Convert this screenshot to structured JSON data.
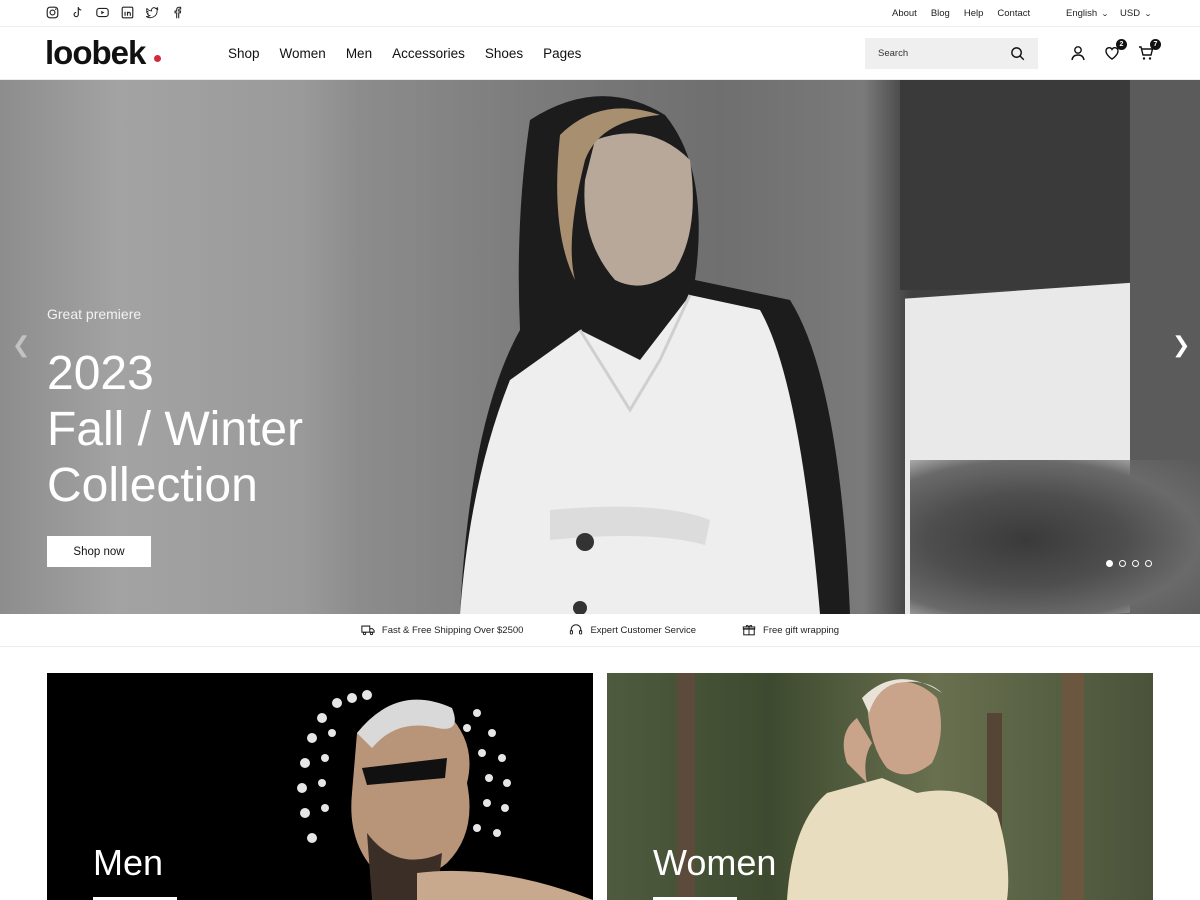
{
  "topbar": {
    "social_icons": [
      "instagram-icon",
      "tiktok-icon",
      "youtube-icon",
      "linkedin-icon",
      "twitter-icon",
      "facebook-icon"
    ],
    "links": [
      "About",
      "Blog",
      "Help",
      "Contact"
    ],
    "language": "English",
    "currency": "USD"
  },
  "header": {
    "logo": "loobek",
    "nav": [
      "Shop",
      "Women",
      "Men",
      "Accessories",
      "Shoes",
      "Pages"
    ],
    "search_placeholder": "Search",
    "wishlist_count": "2",
    "cart_count": "7"
  },
  "hero": {
    "subtitle": "Great premiere",
    "title_line1": "2023",
    "title_line2": "Fall / Winter",
    "title_line3": "Collection",
    "button": "Shop now",
    "slide_count": 4,
    "active_slide": 1
  },
  "features": [
    {
      "icon": "truck-icon",
      "text": "Fast & Free Shipping Over $2500"
    },
    {
      "icon": "headset-icon",
      "text": "Expert Customer Service"
    },
    {
      "icon": "gift-icon",
      "text": "Free gift wrapping"
    }
  ],
  "categories": [
    {
      "title": "Men"
    },
    {
      "title": "Women"
    }
  ],
  "colors": {
    "accent": "#d32a3c",
    "text": "#111111"
  }
}
